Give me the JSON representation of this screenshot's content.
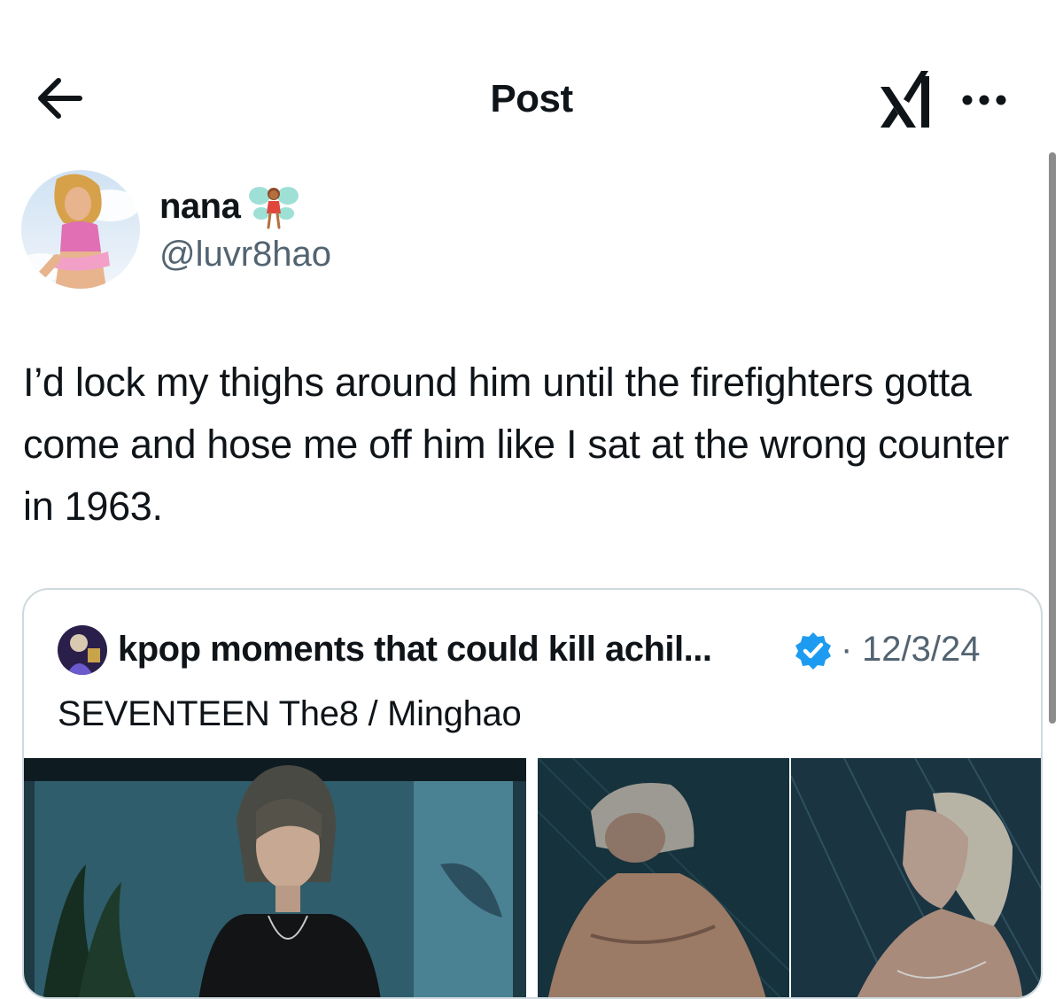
{
  "header": {
    "title": "Post",
    "back_icon": "arrow-left-icon",
    "logo_icon": "xai-logo-icon",
    "more_icon": "more-horizontal-icon"
  },
  "author": {
    "display_name": "nana",
    "name_emoji": "fairy-emoji",
    "handle": "@luvr8hao",
    "avatar": "profile-photo"
  },
  "tweet": {
    "text": "I’d lock my thighs around him until the firefighters gotta come and hose me off him like I sat at the wrong counter in 1963."
  },
  "quoted": {
    "display_name": "kpop moments that could kill achil...",
    "verified": true,
    "separator": "·",
    "date": "12/3/24",
    "text": "SEVENTEEN The8 / Minghao",
    "media": [
      "photo-portrait",
      "photo-back-in-rain",
      "photo-face-up-in-rain"
    ]
  },
  "colors": {
    "text_primary": "#0f1419",
    "text_secondary": "#536471",
    "border": "#cfd9de",
    "verified_blue": "#1d9bf0"
  }
}
